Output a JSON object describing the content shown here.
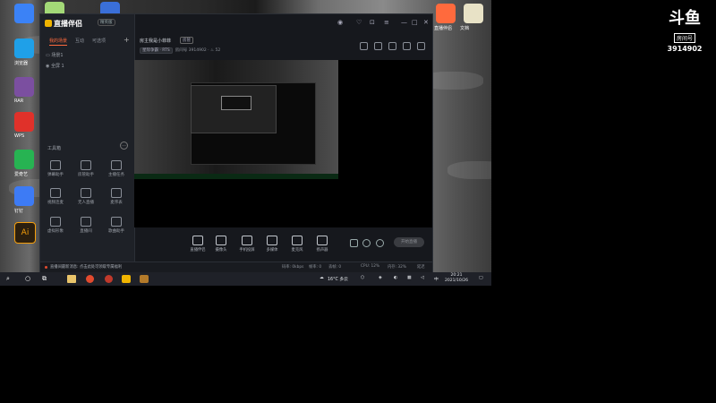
{
  "app": {
    "logo": "直播伴侣",
    "version_badge": "精英版"
  },
  "sidebar": {
    "tabs": [
      {
        "label": "我的场景",
        "active": true
      },
      {
        "label": "互动",
        "active": false
      },
      {
        "label": "可选项",
        "active": false
      }
    ],
    "scene_name": "场景1",
    "layer_item": "全屏 1",
    "toolbox_title": "工具箱",
    "tools": [
      {
        "label": "弹幕助手",
        "icon": "danmaku-icon"
      },
      {
        "label": "房管助手",
        "icon": "admin-icon"
      },
      {
        "label": "主播任务",
        "icon": "task-icon"
      },
      {
        "label": "视频连麦",
        "icon": "video-link-icon"
      },
      {
        "label": "无人直播",
        "icon": "unattended-icon"
      },
      {
        "label": "麦序表",
        "icon": "mic-list-icon"
      },
      {
        "label": "虚拟形象",
        "icon": "avatar-icon"
      },
      {
        "label": "直播间",
        "icon": "live-room-icon"
      },
      {
        "label": "歌曲助手",
        "icon": "music-icon"
      }
    ]
  },
  "header": {
    "room_title": "房主我是小菲菲",
    "room_badge": "房管",
    "category_tag": "星际争霸 · RTS",
    "sub_label": "房间号",
    "room_id": "3914902",
    "heat_value": "52"
  },
  "controls": [
    {
      "label": "直播伴侣",
      "icon": "screen-icon"
    },
    {
      "label": "摄像头",
      "icon": "camera-icon"
    },
    {
      "label": "手机投屏",
      "icon": "phone-cast-icon"
    },
    {
      "label": "多媒体",
      "icon": "media-icon"
    },
    {
      "label": "麦克风",
      "icon": "microphone-icon"
    },
    {
      "label": "扬声器",
      "icon": "speaker-icon"
    }
  ],
  "live_button": "开始直播",
  "status_bar": {
    "notice": "直播间最新消息: 点击此处可领取专属福利",
    "stats": [
      "码率: 0kbps",
      "帧率: 0",
      "丢帧: 0",
      "CPU: 12%",
      "内存: 32%",
      "延迟"
    ]
  },
  "desktop_icons": [
    {
      "label": "迅雷",
      "color": "#3b82f6"
    },
    {
      "label": "浏览器",
      "color": "#1fa0e8"
    },
    {
      "label": "RAR",
      "color": "#7b4fa0"
    },
    {
      "label": "WPS",
      "color": "#e0312a"
    },
    {
      "label": "爱奇艺",
      "color": "#27b352"
    },
    {
      "label": "钉钉",
      "color": "#3d7bf5"
    },
    {
      "label": "Ai",
      "color": "#2b1f0f"
    }
  ],
  "top_desktop_icons": [
    "音乐",
    "网盘"
  ],
  "right_desktop_icons": [
    "直播伴侣",
    "文档"
  ],
  "taskbar": {
    "weather": "16°C 多云",
    "time": "20:21",
    "date": "2021/10/26"
  },
  "douyu": {
    "logo": "斗鱼",
    "room_label": "房间号",
    "room_number": "3914902"
  },
  "colors": {
    "accent": "#ff6a3d",
    "taskbar": "#1f2128"
  }
}
